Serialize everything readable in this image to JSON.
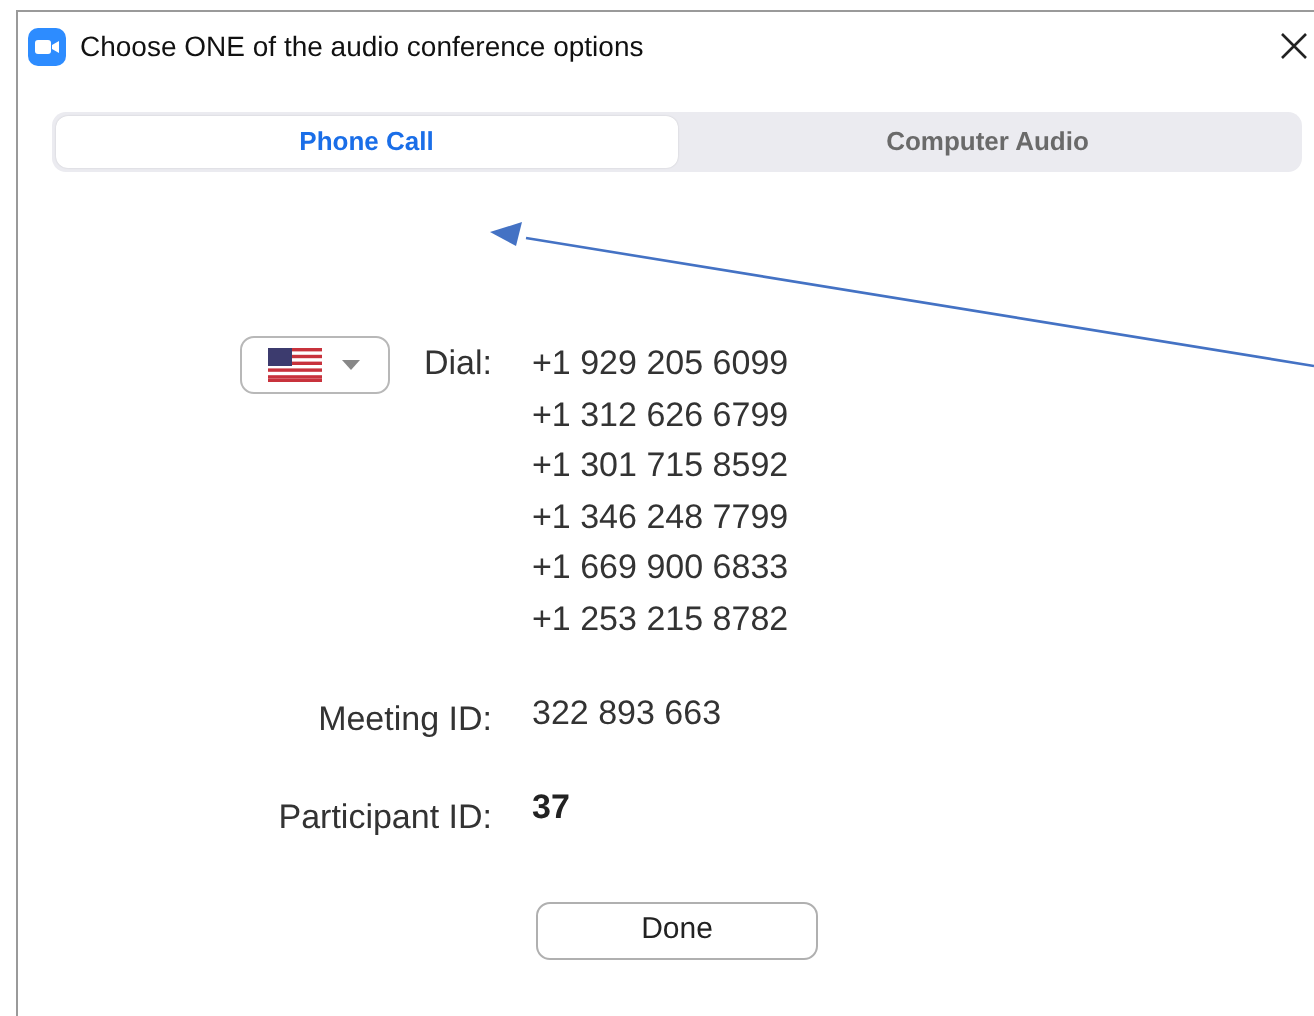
{
  "window": {
    "title": "Choose ONE of the audio conference options"
  },
  "tabs": [
    {
      "label": "Phone Call",
      "selected": true
    },
    {
      "label": "Computer Audio",
      "selected": false
    }
  ],
  "dial": {
    "label": "Dial:",
    "numbers": [
      "+1 929 205 6099",
      "+1 312 626 6799",
      "+1 301 715 8592",
      "+1 346 248 7799",
      "+1 669 900 6833",
      "+1 253 215 8782"
    ]
  },
  "meeting_id": {
    "label": "Meeting ID:",
    "value": "322 893 663"
  },
  "participant_id": {
    "label": "Participant ID:",
    "value": "37"
  },
  "buttons": [
    "Done"
  ]
}
